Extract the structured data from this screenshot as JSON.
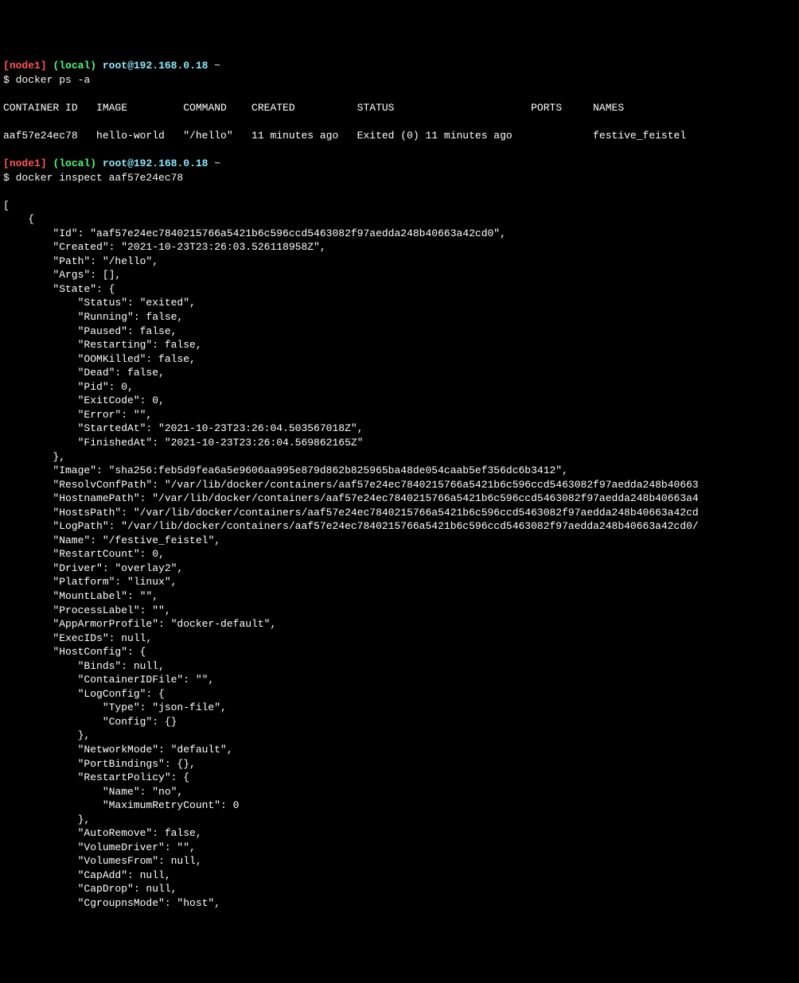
{
  "prompt1": {
    "bracket_open": "[",
    "node": "node1",
    "bracket_close": "]",
    "local": " (local)",
    "user_host": " root@192.168.0.18",
    "path": " ~",
    "command": "$ docker ps -a"
  },
  "ps_header": "CONTAINER ID   IMAGE         COMMAND    CREATED          STATUS                      PORTS     NAMES",
  "ps_row": "aaf57e24ec78   hello-world   \"/hello\"   11 minutes ago   Exited (0) 11 minutes ago             festive_feistel",
  "prompt2": {
    "bracket_open": "[",
    "node": "node1",
    "bracket_close": "]",
    "local": " (local)",
    "user_host": " root@192.168.0.18",
    "path": " ~",
    "command": "$ docker inspect aaf57e24ec78"
  },
  "json_lines": [
    {
      "indent": 0,
      "text": "["
    },
    {
      "indent": 1,
      "text": "{"
    },
    {
      "indent": 2,
      "text": "\"Id\": \"aaf57e24ec7840215766a5421b6c596ccd5463082f97aedda248b40663a42cd0\","
    },
    {
      "indent": 2,
      "text": "\"Created\": \"2021-10-23T23:26:03.526118958Z\","
    },
    {
      "indent": 2,
      "text": "\"Path\": \"/hello\","
    },
    {
      "indent": 2,
      "text": "\"Args\": [],"
    },
    {
      "indent": 2,
      "text": "\"State\": {"
    },
    {
      "indent": 3,
      "text": "\"Status\": \"exited\","
    },
    {
      "indent": 3,
      "text": "\"Running\": false,"
    },
    {
      "indent": 3,
      "text": "\"Paused\": false,"
    },
    {
      "indent": 3,
      "text": "\"Restarting\": false,"
    },
    {
      "indent": 3,
      "text": "\"OOMKilled\": false,"
    },
    {
      "indent": 3,
      "text": "\"Dead\": false,"
    },
    {
      "indent": 3,
      "text": "\"Pid\": 0,"
    },
    {
      "indent": 3,
      "text": "\"ExitCode\": 0,"
    },
    {
      "indent": 3,
      "text": "\"Error\": \"\","
    },
    {
      "indent": 3,
      "text": "\"StartedAt\": \"2021-10-23T23:26:04.503567018Z\","
    },
    {
      "indent": 3,
      "text": "\"FinishedAt\": \"2021-10-23T23:26:04.569862165Z\""
    },
    {
      "indent": 2,
      "text": "},"
    },
    {
      "indent": 2,
      "text": "\"Image\": \"sha256:feb5d9fea6a5e9606aa995e879d862b825965ba48de054caab5ef356dc6b3412\","
    },
    {
      "indent": 2,
      "text": "\"ResolvConfPath\": \"/var/lib/docker/containers/aaf57e24ec7840215766a5421b6c596ccd5463082f97aedda248b40663"
    },
    {
      "indent": 2,
      "text": "\"HostnamePath\": \"/var/lib/docker/containers/aaf57e24ec7840215766a5421b6c596ccd5463082f97aedda248b40663a4"
    },
    {
      "indent": 2,
      "text": "\"HostsPath\": \"/var/lib/docker/containers/aaf57e24ec7840215766a5421b6c596ccd5463082f97aedda248b40663a42cd"
    },
    {
      "indent": 2,
      "text": "\"LogPath\": \"/var/lib/docker/containers/aaf57e24ec7840215766a5421b6c596ccd5463082f97aedda248b40663a42cd0/"
    },
    {
      "indent": 2,
      "text": "\"Name\": \"/festive_feistel\","
    },
    {
      "indent": 2,
      "text": "\"RestartCount\": 0,"
    },
    {
      "indent": 2,
      "text": "\"Driver\": \"overlay2\","
    },
    {
      "indent": 2,
      "text": "\"Platform\": \"linux\","
    },
    {
      "indent": 2,
      "text": "\"MountLabel\": \"\","
    },
    {
      "indent": 2,
      "text": "\"ProcessLabel\": \"\","
    },
    {
      "indent": 2,
      "text": "\"AppArmorProfile\": \"docker-default\","
    },
    {
      "indent": 2,
      "text": "\"ExecIDs\": null,"
    },
    {
      "indent": 2,
      "text": "\"HostConfig\": {"
    },
    {
      "indent": 3,
      "text": "\"Binds\": null,"
    },
    {
      "indent": 3,
      "text": "\"ContainerIDFile\": \"\","
    },
    {
      "indent": 3,
      "text": "\"LogConfig\": {"
    },
    {
      "indent": 4,
      "text": "\"Type\": \"json-file\","
    },
    {
      "indent": 4,
      "text": "\"Config\": {}"
    },
    {
      "indent": 3,
      "text": "},"
    },
    {
      "indent": 3,
      "text": "\"NetworkMode\": \"default\","
    },
    {
      "indent": 3,
      "text": "\"PortBindings\": {},"
    },
    {
      "indent": 3,
      "text": "\"RestartPolicy\": {"
    },
    {
      "indent": 4,
      "text": "\"Name\": \"no\","
    },
    {
      "indent": 4,
      "text": "\"MaximumRetryCount\": 0"
    },
    {
      "indent": 3,
      "text": "},"
    },
    {
      "indent": 3,
      "text": "\"AutoRemove\": false,"
    },
    {
      "indent": 3,
      "text": "\"VolumeDriver\": \"\","
    },
    {
      "indent": 3,
      "text": "\"VolumesFrom\": null,"
    },
    {
      "indent": 3,
      "text": "\"CapAdd\": null,"
    },
    {
      "indent": 3,
      "text": "\"CapDrop\": null,"
    },
    {
      "indent": 3,
      "text": "\"CgroupnsMode\": \"host\","
    }
  ]
}
